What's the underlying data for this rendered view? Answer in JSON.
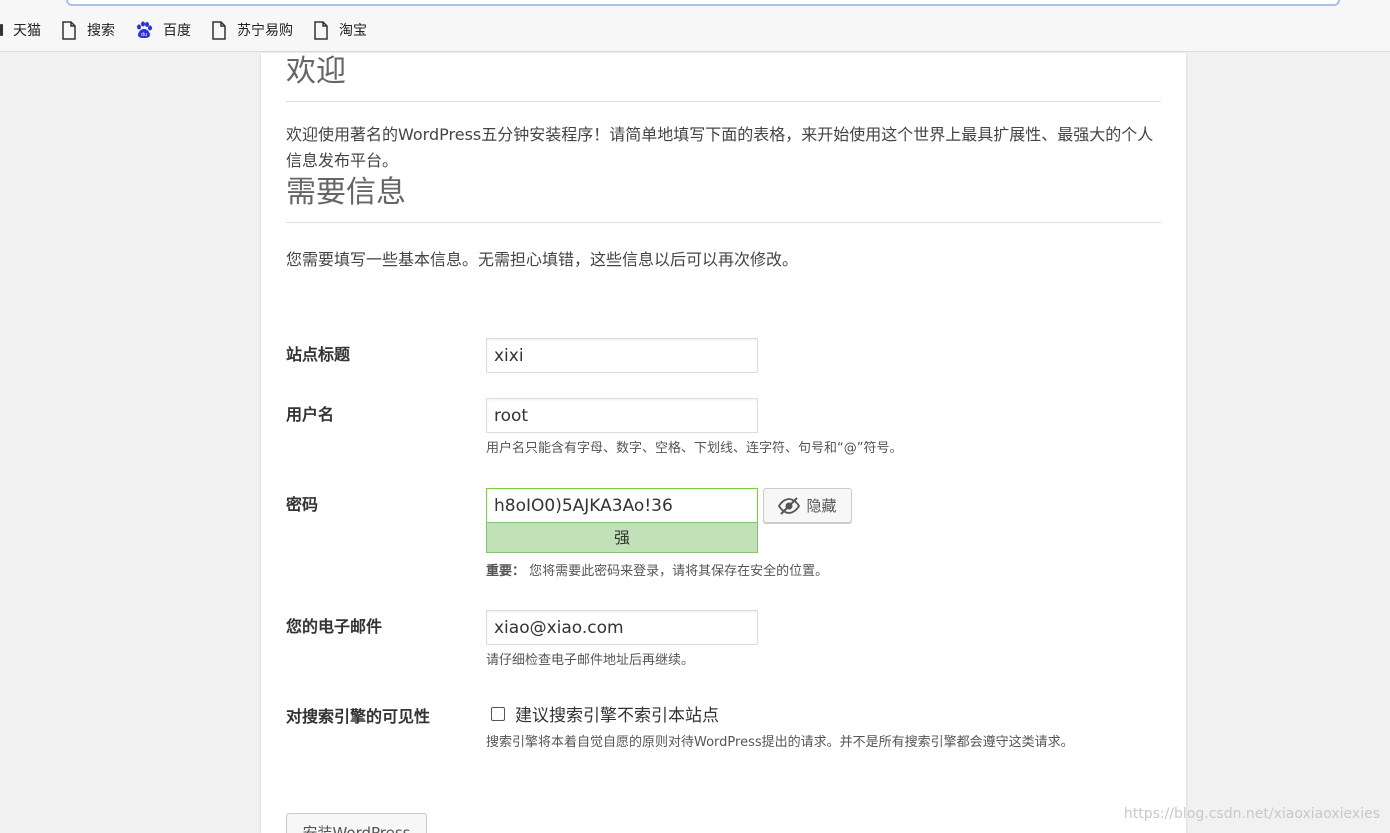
{
  "browser": {
    "bookmarks": [
      {
        "label": "天猫",
        "icon": "page-icon"
      },
      {
        "label": "搜索",
        "icon": "page-icon"
      },
      {
        "label": "百度",
        "icon": "baidu-paw-icon"
      },
      {
        "label": "苏宁易购",
        "icon": "page-icon"
      },
      {
        "label": "淘宝",
        "icon": "page-icon"
      }
    ]
  },
  "welcome": {
    "heading": "欢迎",
    "intro": "欢迎使用著名的WordPress五分钟安装程序！请简单地填写下面的表格，来开始使用这个世界上最具扩展性、最强大的个人信息发布平台。"
  },
  "info": {
    "heading": "需要信息",
    "description": "您需要填写一些基本信息。无需担心填错，这些信息以后可以再次修改。"
  },
  "form": {
    "site_title": {
      "label": "站点标题",
      "value": "xixi"
    },
    "username": {
      "label": "用户名",
      "value": "root",
      "hint": "用户名只能含有字母、数字、空格、下划线、连字符、句号和“@”符号。"
    },
    "password": {
      "label": "密码",
      "value": "h8oIO0)5AJKA3Ao!36",
      "hide_label": "隐藏",
      "strength": "强",
      "strength_color": "#c1e1b9",
      "important_label": "重要：",
      "important_text": "您将需要此密码来登录，请将其保存在安全的位置。"
    },
    "email": {
      "label": "您的电子邮件",
      "value": "xiao@xiao.com",
      "hint": "请仔细检查电子邮件地址后再继续。"
    },
    "visibility": {
      "label": "对搜索引擎的可见性",
      "checkbox_label": "建议搜索引擎不索引本站点",
      "checked": false,
      "hint": "搜索引擎将本着自觉自愿的原则对待WordPress提出的请求。并不是所有搜索引擎都会遵守这类请求。"
    },
    "submit_label": "安装WordPress"
  },
  "watermark": "https://blog.csdn.net/xiaoxiaoxiexies"
}
